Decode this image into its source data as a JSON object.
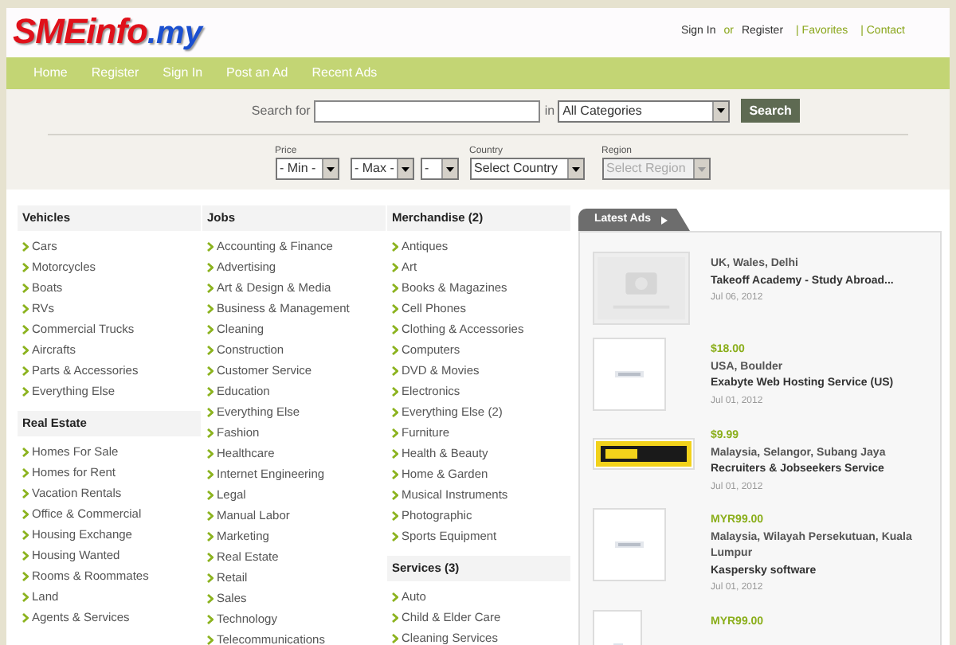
{
  "header": {
    "logo_main": "SMEinfo",
    "logo_suffix": ".my",
    "links": [
      {
        "label": "Sign In",
        "kind": "dark"
      },
      {
        "label": "or",
        "kind": "sep"
      },
      {
        "label": "Register",
        "kind": "dark"
      },
      {
        "label": "| Favorites",
        "kind": "green"
      },
      {
        "label": "| Contact",
        "kind": "green"
      }
    ]
  },
  "nav": [
    "Home",
    "Register",
    "Sign In",
    "Post an Ad",
    "Recent Ads"
  ],
  "search": {
    "label": "Search for",
    "in_label": "in",
    "category": "All Categories",
    "button": "Search"
  },
  "filters": [
    {
      "label": "Price",
      "value": "- Min -",
      "disabled": false
    },
    {
      "value": "- Max -",
      "disabled": false
    },
    {
      "value": "-",
      "disabled": false
    },
    {
      "label": "Country",
      "value": "Select Country",
      "disabled": false
    },
    {
      "label": "Region",
      "value": "Select Region",
      "disabled": true
    }
  ],
  "columns": [
    [
      {
        "title": "Vehicles",
        "items": [
          "Cars",
          "Motorcycles",
          "Boats",
          "RVs",
          "Commercial Trucks",
          "Aircrafts",
          "Parts & Accessories",
          "Everything Else"
        ]
      },
      {
        "title": "Real Estate",
        "items": [
          "Homes For Sale",
          "Homes for Rent",
          "Vacation Rentals",
          "Office & Commercial",
          "Housing Exchange",
          "Housing Wanted",
          "Rooms & Roommates",
          "Land",
          "Agents & Services"
        ]
      }
    ],
    [
      {
        "title": "Jobs",
        "items": [
          "Accounting & Finance",
          "Advertising",
          "Art & Design & Media",
          "Business & Management",
          "Cleaning",
          "Construction",
          "Customer Service",
          "Education",
          "Everything Else",
          "Fashion",
          "Healthcare",
          "Internet Engineering",
          "Legal",
          "Manual Labor",
          "Marketing",
          "Real Estate",
          "Retail",
          "Sales",
          "Technology",
          "Telecommunications"
        ]
      }
    ],
    [
      {
        "title": "Merchandise (2)",
        "items": [
          "Antiques",
          "Art",
          "Books & Magazines",
          "Cell Phones",
          "Clothing & Accessories",
          "Computers",
          "DVD & Movies",
          "Electronics",
          "Everything Else (2)",
          "Furniture",
          "Health & Beauty",
          "Home & Garden",
          "Musical Instruments",
          "Photographic",
          "Sports Equipment"
        ]
      },
      {
        "title": "Services (3)",
        "items": [
          "Auto",
          "Child & Elder Care",
          "Cleaning Services"
        ]
      }
    ]
  ],
  "latest_ads": {
    "tab": "Latest Ads",
    "ads": [
      {
        "kind": "placeholder",
        "location": "UK, Wales, Delhi",
        "title": "Takeoff Academy - Study Abroad...",
        "date": "Jul 06, 2012"
      },
      {
        "kind": "plain",
        "price": "$18.00",
        "location": "USA, Boulder",
        "title": "Exabyte Web Hosting Service (US)",
        "date": "Jul 01, 2012"
      },
      {
        "kind": "banner",
        "price": "$9.99",
        "location": "Malaysia, Selangor, Subang Jaya",
        "title": "Recruiters & Jobseekers Service",
        "date": "Jul 01, 2012"
      },
      {
        "kind": "plain",
        "price": "MYR99.00",
        "location": "Malaysia, Wilayah Persekutuan, Kuala Lumpur",
        "title": "Kaspersky software",
        "date": "Jul 01, 2012"
      },
      {
        "kind": "small",
        "price": "MYR99.00"
      }
    ]
  }
}
